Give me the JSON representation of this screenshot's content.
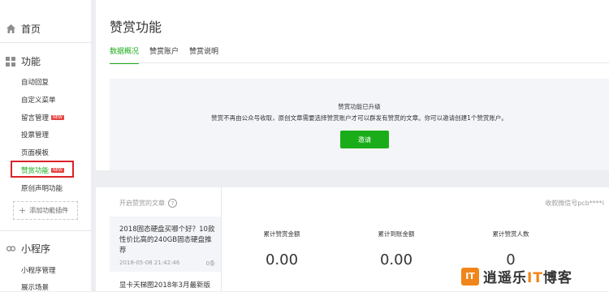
{
  "sidebar": {
    "home": "首页",
    "features": {
      "label": "功能",
      "items": [
        {
          "label": "自动回复"
        },
        {
          "label": "自定义菜单"
        },
        {
          "label": "留言管理",
          "badge": "NEW"
        },
        {
          "label": "投票管理"
        },
        {
          "label": "页面模板"
        },
        {
          "label": "赞赏功能",
          "badge": "NEW"
        },
        {
          "label": "原创声明功能"
        }
      ],
      "add_plugin": "添加功能插件"
    },
    "mini_program": {
      "label": "小程序",
      "items": [
        {
          "label": "小程序管理"
        },
        {
          "label": "展示场景"
        }
      ]
    }
  },
  "main": {
    "title": "赞赏功能",
    "tabs": [
      {
        "label": "数据概况",
        "active": true
      },
      {
        "label": "赞赏账户"
      },
      {
        "label": "赞赏说明"
      }
    ],
    "notice": {
      "title": "赞赏功能已升级",
      "description": "赞赏不再由公众号收取，原创文章需要选择赞赏账户才可以群发有赞赏的文章。你可以邀请创建1个赞赏账户。",
      "button": "邀请"
    },
    "articles": {
      "header": "开启赞赏的文章",
      "list": [
        {
          "title": "2018固态硬盘买哪个好？10款性价比高的240GB固态硬盘推荐",
          "date": "2018-05-08 21:42:46",
          "count": "0条"
        },
        {
          "title": "显卡天梯图2018年3月最新版"
        }
      ]
    },
    "account_label": "收款微信号pcb****i",
    "stats": [
      {
        "label": "累计赞赏金额",
        "value": "0.00"
      },
      {
        "label": "累计到账金额",
        "value": "0.00"
      },
      {
        "label": "累计赞赏人数",
        "value": "0"
      }
    ]
  },
  "watermark": {
    "logo": "IT",
    "text_before": "逍遥乐",
    "text_highlight": "IT",
    "text_after": "博客"
  },
  "colors": {
    "accent": "#1aad19",
    "badge": "#e64340",
    "highlight_border": "#d9242a"
  }
}
